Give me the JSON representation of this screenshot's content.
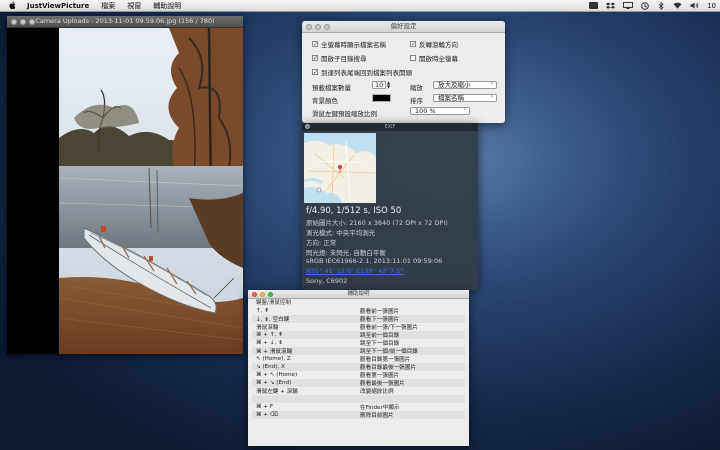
{
  "menubar": {
    "app_name": "JustViewPicture",
    "items": [
      "檔案",
      "視窗",
      "輔助說明"
    ],
    "right_text": "10"
  },
  "viewer": {
    "title": "Camera Uploads - 2013-11-01 09.59.06.jpg (156 / 780)"
  },
  "prefs": {
    "title": "偏好設定",
    "checkboxes": [
      {
        "label": "全螢幕時顯示檔案名稱",
        "checked": true
      },
      {
        "label": "反轉滾輪方向",
        "checked": true
      },
      {
        "label": "開啟子目錄搜尋",
        "checked": true
      },
      {
        "label": "開啟時全螢幕",
        "checked": false
      },
      {
        "label": "到達列表尾端回到檔案列表開頭",
        "checked": true
      }
    ],
    "preload_label": "預載檔案數量",
    "preload_value": "10",
    "bg_color_label": "背景顏色",
    "bg_color": "#000000",
    "scroll_zoom_label": "滑鼠左鍵預設縮放比例",
    "zoom_label": "縮放",
    "zoom_value": "放大及縮小",
    "sort_label": "排序",
    "sort_value": "檔案名稱",
    "scale_value": "100 %"
  },
  "exif": {
    "title": "EXIF",
    "summary": "f/4.90, 1/512 s, ISO 50",
    "lines": [
      "原始圖片大小: 2160 x 3840 (72 DPI x 72 DPI)",
      "測光模式: 中央平均測光",
      "方向: 正常",
      "閃光燈: 未閃光, 自動白平衡",
      "sRGB IEC61966-2.1, 2013:11:01 09:59:06"
    ],
    "gps_link": "N35° 41' 12.6\" E139° 42' 7.5\"",
    "camera": "Sony, C6902"
  },
  "help": {
    "title": "輔助說明",
    "header": "鍵盤/滑鼠控制",
    "rows": [
      [
        "↑, ⇞",
        "觀看前一張圖片"
      ],
      [
        "↓, ⇟, 空白鍵",
        "觀看下一張圖片"
      ],
      [
        "滑鼠滾輪",
        "觀看前一張/下一張圖片"
      ],
      [
        "⌘ + ↑, ⇞",
        "跳至前一個目錄"
      ],
      [
        "⌘ + ↓, ⇟",
        "跳至下一個目錄"
      ],
      [
        "⌘ + 滑鼠滾輪",
        "跳至下一個/前一個目錄"
      ],
      [
        "↖ (Home), Z",
        "觀看目錄第一張圖片"
      ],
      [
        "↘ (End), X",
        "觀看目錄最後一張圖片"
      ],
      [
        "⌘ + ↖ (Home)",
        "觀看第一張圖片"
      ],
      [
        "⌘ + ↘ (End)",
        "觀看最後一張圖片"
      ],
      [
        "滑鼠左鍵 + 滾輪",
        "改變縮放比例"
      ],
      [
        "",
        ""
      ],
      [
        "⌘ + F",
        "在Finder中顯示"
      ],
      [
        "⌘ + ⌫",
        "刪除目前圖片"
      ]
    ]
  }
}
